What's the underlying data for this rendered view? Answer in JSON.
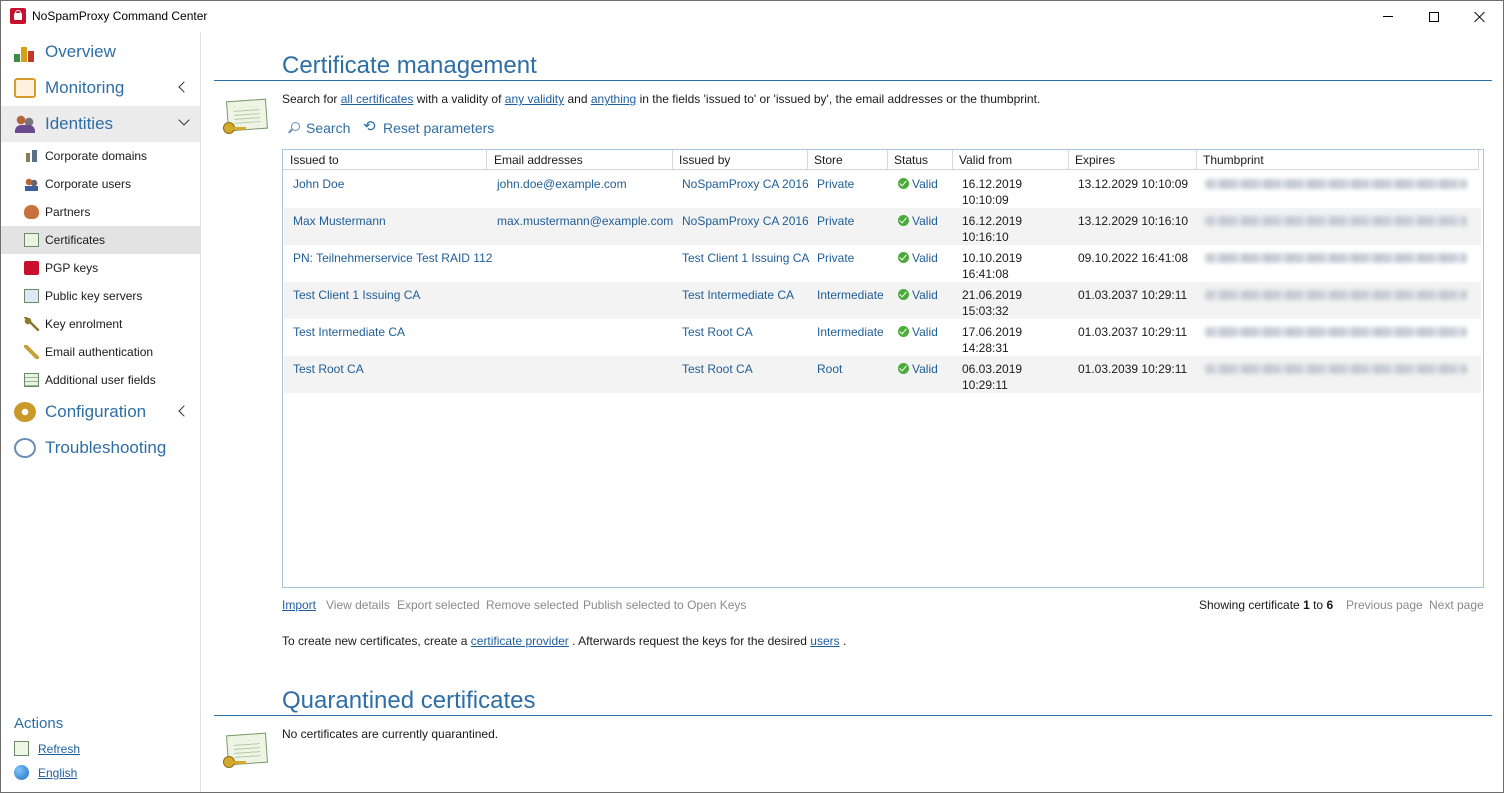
{
  "window": {
    "title": "NoSpamProxy Command Center"
  },
  "sidebar": {
    "main_items": [
      {
        "label": "Overview",
        "icon": "chart-icon"
      },
      {
        "label": "Monitoring",
        "icon": "monitor-icon"
      },
      {
        "label": "Identities",
        "icon": "identities-icon"
      },
      {
        "label": "Configuration",
        "icon": "gear-icon"
      },
      {
        "label": "Troubleshooting",
        "icon": "magnifier-icon"
      }
    ],
    "sub_items": [
      {
        "label": "Corporate domains",
        "icon": "domains-icon"
      },
      {
        "label": "Corporate users",
        "icon": "users-icon"
      },
      {
        "label": "Partners",
        "icon": "handshake-icon"
      },
      {
        "label": "Certificates",
        "icon": "certificate-icon"
      },
      {
        "label": "PGP keys",
        "icon": "pgp-key-icon"
      },
      {
        "label": "Public key servers",
        "icon": "key-server-icon"
      },
      {
        "label": "Key enrolment",
        "icon": "key-icon"
      },
      {
        "label": "Email authentication",
        "icon": "email-auth-icon"
      },
      {
        "label": "Additional user fields",
        "icon": "user-fields-icon"
      }
    ],
    "actions_title": "Actions",
    "actions": [
      {
        "label": "Refresh",
        "icon": "refresh-icon"
      },
      {
        "label": "English",
        "icon": "globe-icon"
      }
    ]
  },
  "main": {
    "title": "Certificate management",
    "search": {
      "prefix": "Search for ",
      "link_certificates": "all certificates",
      "mid1": " with a validity of ",
      "link_validity": "any validity",
      "mid2": " and ",
      "link_fields": "anything",
      "suffix": " in the fields 'issued to' or 'issued by', the email addresses or the thumbprint."
    },
    "toolbar": {
      "search": "Search",
      "reset": "Reset parameters"
    },
    "table": {
      "headers": [
        "Issued to",
        "Email addresses",
        "Issued by",
        "Store",
        "Status",
        "Valid from",
        "Expires",
        "Thumbprint"
      ],
      "rows": [
        {
          "issued_to": "John Doe",
          "email": "john.doe@example.com",
          "issued_by": "NoSpamProxy CA 2016",
          "store": "Private",
          "status": "Valid",
          "valid_from_date": "16.12.2019",
          "valid_from_time": "10:10:09",
          "expires": "13.12.2029 10:10:09"
        },
        {
          "issued_to": "Max Mustermann",
          "email": "max.mustermann@example.com",
          "issued_by": "NoSpamProxy CA 2016",
          "store": "Private",
          "status": "Valid",
          "valid_from_date": "16.12.2019",
          "valid_from_time": "10:16:10",
          "expires": "13.12.2029 10:16:10"
        },
        {
          "issued_to": "PN: Teilnehmerservice Test RAID 112",
          "email": "",
          "issued_by": "Test Client 1 Issuing CA",
          "store": "Private",
          "status": "Valid",
          "valid_from_date": "10.10.2019",
          "valid_from_time": "16:41:08",
          "expires": "09.10.2022 16:41:08"
        },
        {
          "issued_to": "Test Client 1 Issuing CA",
          "email": "",
          "issued_by": "Test Intermediate CA",
          "store": "Intermediate",
          "status": "Valid",
          "valid_from_date": "21.06.2019",
          "valid_from_time": "15:03:32",
          "expires": "01.03.2037 10:29:11"
        },
        {
          "issued_to": "Test Intermediate CA",
          "email": "",
          "issued_by": "Test Root CA",
          "store": "Intermediate",
          "status": "Valid",
          "valid_from_date": "17.06.2019",
          "valid_from_time": "14:28:31",
          "expires": "01.03.2037 10:29:11"
        },
        {
          "issued_to": "Test Root CA",
          "email": "",
          "issued_by": "Test Root CA",
          "store": "Root",
          "status": "Valid",
          "valid_from_date": "06.03.2019",
          "valid_from_time": "10:29:11",
          "expires": "01.03.2039 10:29:11"
        }
      ]
    },
    "bottom_actions": {
      "import": "Import",
      "view_details": "View details",
      "export_selected": "Export selected",
      "remove_selected": "Remove selected",
      "publish_selected": "Publish selected to Open Keys"
    },
    "paging": {
      "prefix": "Showing certificate ",
      "from": "1",
      "mid": " to ",
      "to": "6",
      "previous": "Previous page",
      "next": "Next page"
    },
    "info": {
      "prefix": "To create new certificates, create a ",
      "link_provider": "certificate provider",
      "mid": " . Afterwards request the keys for the desired ",
      "link_users": "users",
      "suffix": " ."
    },
    "quarantine": {
      "title": "Quarantined certificates",
      "message": "No certificates are currently quarantined."
    }
  },
  "colors": {
    "accent": "#2e6ea6",
    "link": "#1f5fa0",
    "valid": "#4caa3a"
  }
}
